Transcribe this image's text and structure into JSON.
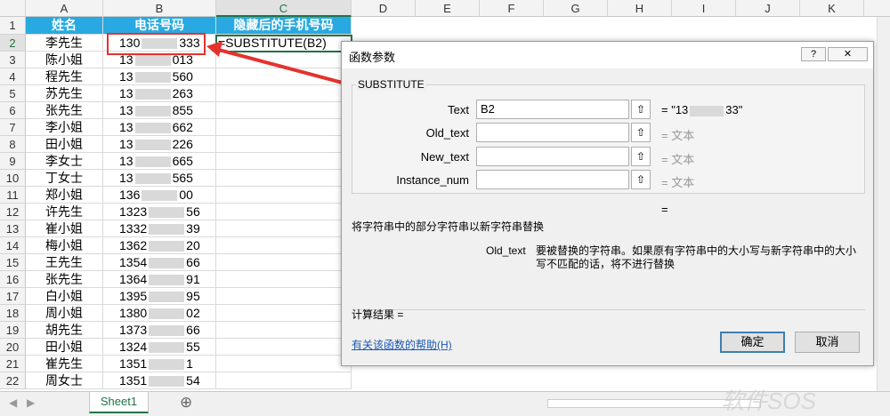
{
  "columns": [
    "A",
    "B",
    "C",
    "D",
    "E",
    "F",
    "G",
    "H",
    "I",
    "J",
    "K"
  ],
  "header_row": {
    "a": "姓名",
    "b": "电话号码",
    "c": "隐藏后的手机号码"
  },
  "rows": [
    {
      "num": "2",
      "name": "李先生",
      "pre": "130",
      "post": "333",
      "c": "=SUBSTITUTE(B2)"
    },
    {
      "num": "3",
      "name": "陈小姐",
      "pre": "13",
      "post": "013",
      "c": ""
    },
    {
      "num": "4",
      "name": "程先生",
      "pre": "13",
      "post": "560",
      "c": ""
    },
    {
      "num": "5",
      "name": "苏先生",
      "pre": "13",
      "post": "263",
      "c": ""
    },
    {
      "num": "6",
      "name": "张先生",
      "pre": "13",
      "post": "855",
      "c": ""
    },
    {
      "num": "7",
      "name": "李小姐",
      "pre": "13",
      "post": "662",
      "c": ""
    },
    {
      "num": "8",
      "name": "田小姐",
      "pre": "13",
      "post": "226",
      "c": ""
    },
    {
      "num": "9",
      "name": "李女士",
      "pre": "13",
      "post": "665",
      "c": ""
    },
    {
      "num": "10",
      "name": "丁女士",
      "pre": "13",
      "post": "565",
      "c": ""
    },
    {
      "num": "11",
      "name": "郑小姐",
      "pre": "136",
      "post": "00",
      "c": ""
    },
    {
      "num": "12",
      "name": "许先生",
      "pre": "1323",
      "post": "56",
      "c": ""
    },
    {
      "num": "13",
      "name": "崔小姐",
      "pre": "1332",
      "post": "39",
      "c": ""
    },
    {
      "num": "14",
      "name": "梅小姐",
      "pre": "1362",
      "post": "20",
      "c": ""
    },
    {
      "num": "15",
      "name": "王先生",
      "pre": "1354",
      "post": "66",
      "c": ""
    },
    {
      "num": "16",
      "name": "张先生",
      "pre": "1364",
      "post": "91",
      "c": ""
    },
    {
      "num": "17",
      "name": "白小姐",
      "pre": "1395",
      "post": "95",
      "c": ""
    },
    {
      "num": "18",
      "name": "周小姐",
      "pre": "1380",
      "post": "02",
      "c": ""
    },
    {
      "num": "19",
      "name": "胡先生",
      "pre": "1373",
      "post": "66",
      "c": ""
    },
    {
      "num": "20",
      "name": "田小姐",
      "pre": "1324",
      "post": "55",
      "c": ""
    },
    {
      "num": "21",
      "name": "崔先生",
      "pre": "1351",
      "post": "1",
      "c": ""
    },
    {
      "num": "22",
      "name": "周女士",
      "pre": "1351",
      "post": "54",
      "c": ""
    }
  ],
  "dialog": {
    "title": "函数参数",
    "help_btn": "?",
    "close_btn": "✕",
    "func_name": "SUBSTITUTE",
    "args": [
      {
        "label": "Text",
        "value": "B2",
        "result": "= \"13",
        "result2": "33\""
      },
      {
        "label": "Old_text",
        "value": "",
        "result": "=  文本",
        "result2": ""
      },
      {
        "label": "New_text",
        "value": "",
        "result": "=  文本",
        "result2": ""
      },
      {
        "label": "Instance_num",
        "value": "",
        "result": "=  文本",
        "result2": ""
      }
    ],
    "eq_alone": "=",
    "description": "将字符串中的部分字符串以新字符串替换",
    "param_name": "Old_text",
    "param_desc1": "要被替换的字符串。如果原有字符串中的大小写与新字符串中的大小",
    "param_desc2": "写不匹配的话，将不进行替换",
    "calc_result": "计算结果 =",
    "help_link": "有关该函数的帮助(H)",
    "ok": "确定",
    "cancel": "取消"
  },
  "sheet_tab": "Sheet1",
  "add_sheet": "⊕",
  "watermark": "软件SOS",
  "colors": {
    "header_fill": "#29a9e1",
    "highlight_red": "#e5322d",
    "excel_green": "#217346"
  }
}
